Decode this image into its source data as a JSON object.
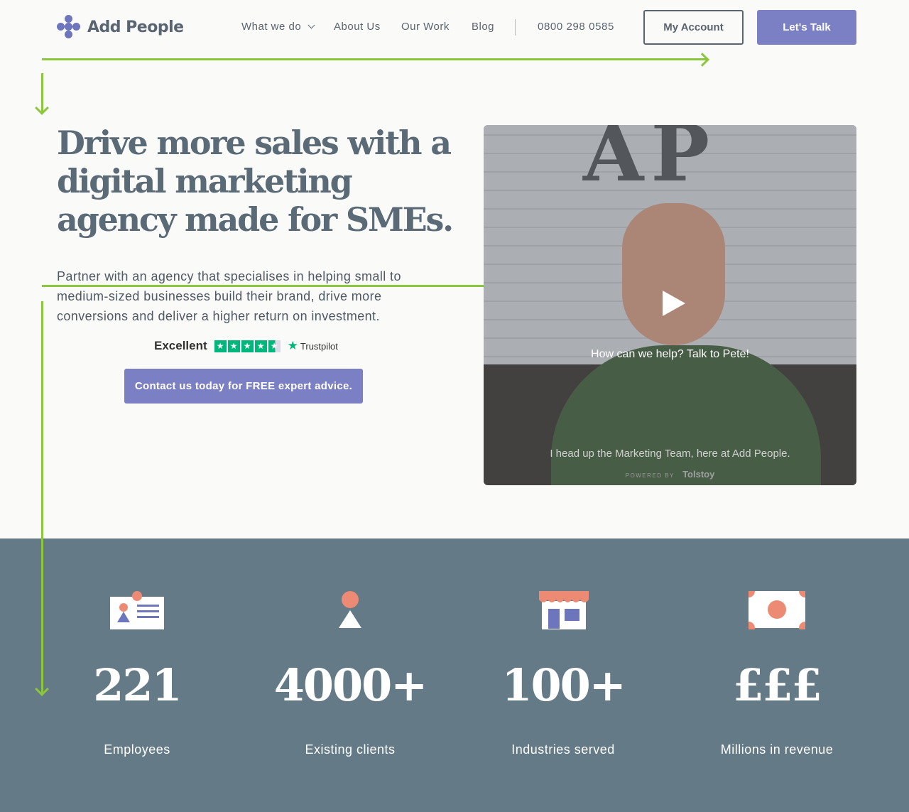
{
  "brand": {
    "name": "Add People",
    "accent": "#7b80c4",
    "dark": "#5a6a77",
    "band": "#647a87",
    "coral": "#ec8a74",
    "guide": "#8cc63f"
  },
  "nav": {
    "items": [
      "What we do",
      "About Us",
      "Our Work",
      "Blog"
    ],
    "phone": "0800 298 0585",
    "account_label": "My Account",
    "talk_label": "Let's Talk"
  },
  "hero": {
    "title": "Drive more sales with a digital marketing agency made for SMEs.",
    "text": "Partner with an agency that specialises in helping small to medium-sized businesses build their brand, drive more conversions and deliver a higher return on investment.",
    "trust_label": "Excellent",
    "trust_brand": "Trustpilot",
    "cta_label": "Contact us today for FREE expert advice."
  },
  "video": {
    "sign": "AP",
    "caption": "How can we help? Talk to Pete!",
    "subtitle": "I head up the Marketing Team, here at Add People.",
    "powered_by": "POWERED BY",
    "powered_brand": "Tolstoy"
  },
  "stats": [
    {
      "icon": "id-card-icon",
      "value": "221",
      "label": "Employees"
    },
    {
      "icon": "person-icon",
      "value": "4000+",
      "label": "Existing clients"
    },
    {
      "icon": "shop-icon",
      "value": "100+",
      "label": "Industries served"
    },
    {
      "icon": "banknote-icon",
      "value": "£££",
      "label": "Millions in revenue"
    }
  ]
}
